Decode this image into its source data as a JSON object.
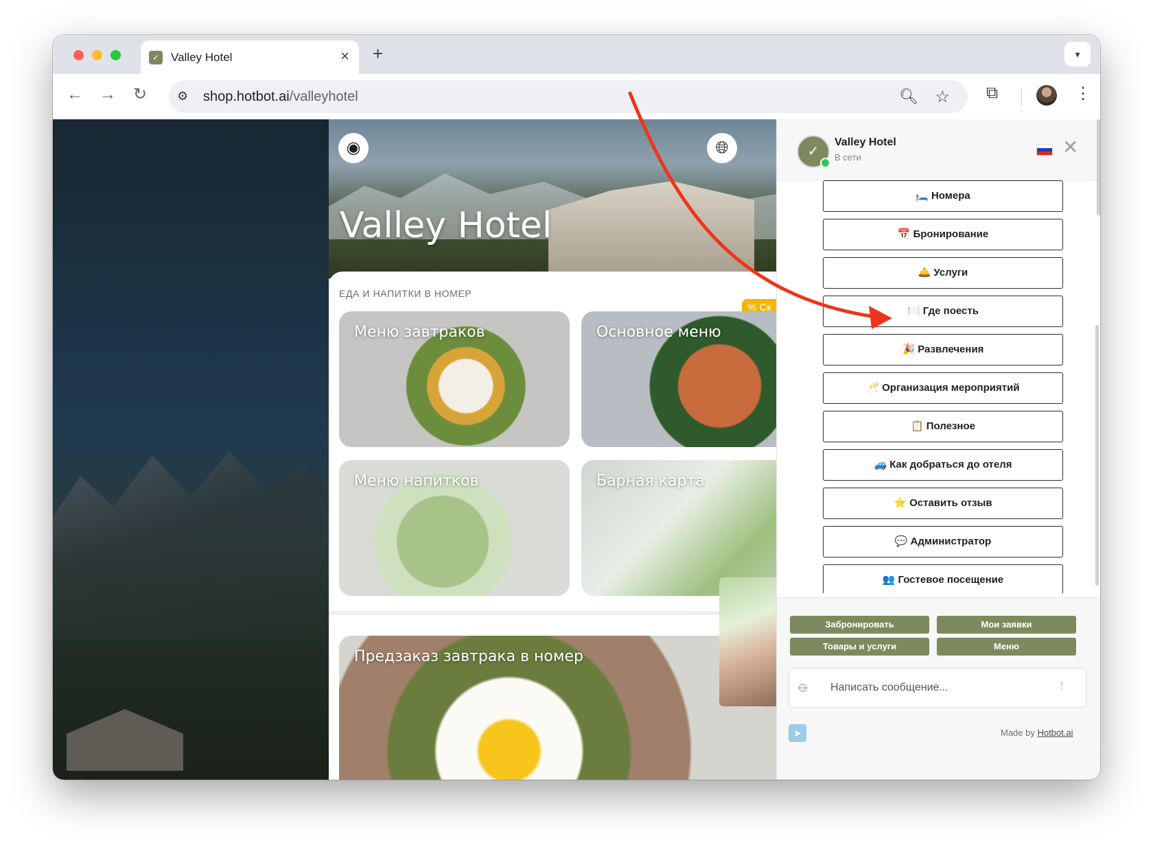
{
  "browser": {
    "tab_title": "Valley Hotel",
    "tab_close": "×",
    "new_tab": "+",
    "url_host": "shop.hotbot.ai",
    "url_path": "/valleyhotel"
  },
  "site": {
    "hotel_title": "Valley Hotel",
    "section_title": "ЕДА И НАПИТКИ В НОМЕР",
    "promo_badge": "% Ск",
    "cards": [
      {
        "label": "Меню завтраков"
      },
      {
        "label": "Основное меню"
      },
      {
        "label": "Меню напитков"
      },
      {
        "label": "Барная карта"
      },
      {
        "label": "Предзаказ завтрака в номер"
      }
    ]
  },
  "chat": {
    "bot_name": "Valley Hotel",
    "status": "В сети",
    "menu_buttons": [
      {
        "emoji": "🛏️",
        "label": "Номера"
      },
      {
        "emoji": "📅",
        "label": "Бронирование"
      },
      {
        "emoji": "🛎️",
        "label": "Услуги"
      },
      {
        "emoji": "🍽️",
        "label": "Где поесть"
      },
      {
        "emoji": "🎉",
        "label": "Развлечения"
      },
      {
        "emoji": "🥂",
        "label": "Организация мероприятий"
      },
      {
        "emoji": "📋",
        "label": "Полезное"
      },
      {
        "emoji": "🚙",
        "label": "Как добраться до отеля"
      },
      {
        "emoji": "⭐",
        "label": "Оставить отзыв"
      },
      {
        "emoji": "💬",
        "label": "Администратор"
      },
      {
        "emoji": "👥",
        "label": "Гостевое посещение"
      }
    ],
    "quick_actions": [
      "Забронировать",
      "Мои заявки",
      "Товары и услуги",
      "Меню"
    ],
    "input_placeholder": "Написать сообщение...",
    "made_by_prefix": "Made by ",
    "made_by_link": "Hotbot.ai"
  },
  "colors": {
    "accent": "#7d8a5e",
    "annotation_arrow": "#f0341b",
    "online": "#34c759",
    "promo": "#f4b400"
  },
  "icons": {
    "back": "arrow-left-icon",
    "forward": "arrow-right-icon",
    "reload": "reload-icon",
    "site_info": "tune-icon",
    "zoom": "zoom-icon",
    "bookmark": "star-icon",
    "extensions": "puzzle-icon",
    "menu": "kebab-icon",
    "user": "user-circle-icon",
    "language": "globe-icon",
    "attach": "paperclip-icon",
    "send": "arrow-up-icon",
    "telegram": "telegram-icon",
    "close": "close-icon"
  }
}
